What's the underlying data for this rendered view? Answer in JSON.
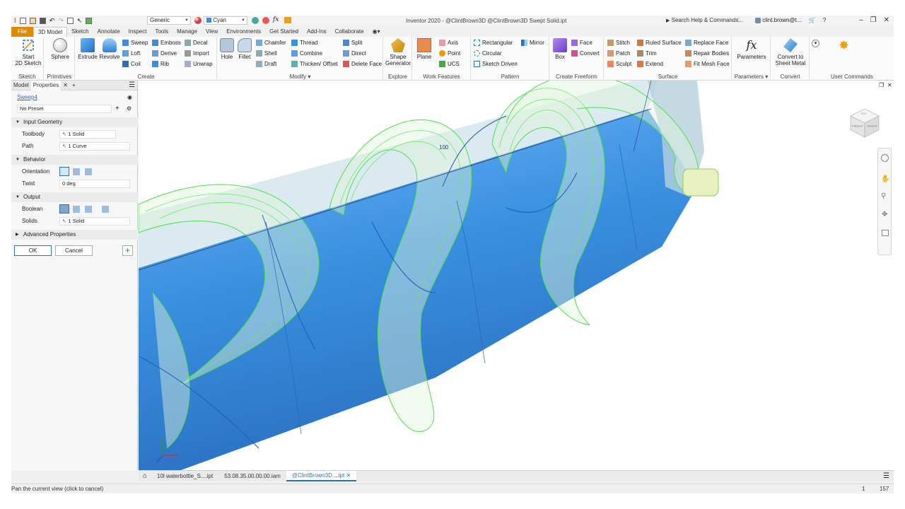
{
  "titlebar": {
    "appearance": "Generic",
    "color": "Cyan",
    "title": "Inventor 2020 - @ClintBrown3D   @ClintBrown3D Swept Solid.ipt",
    "search": "Search Help & Commands...",
    "user": "clint.brown@t..."
  },
  "tabs": [
    "File",
    "3D Model",
    "Sketch",
    "Annotate",
    "Inspect",
    "Tools",
    "Manage",
    "View",
    "Environments",
    "Get Started",
    "Add-Ins",
    "Collaborate"
  ],
  "ribbon": {
    "sketch": {
      "start": "Start",
      "start2": "2D Sketch",
      "label": "Sketch"
    },
    "primitives": {
      "sphere": "Sphere",
      "label": "Primitives"
    },
    "create": {
      "extrude": "Extrude",
      "revolve": "Revolve",
      "sweep": "Sweep",
      "loft": "Loft",
      "coil": "Coil",
      "emboss": "Emboss",
      "derive": "Derive",
      "rib": "Rib",
      "decal": "Decal",
      "import": "Import",
      "unwrap": "Unwrap",
      "label": "Create"
    },
    "modify": {
      "hole": "Hole",
      "fillet": "Fillet",
      "chamfer": "Chamfer",
      "shell": "Shell",
      "draft": "Draft",
      "thread": "Thread",
      "combine": "Combine",
      "thicken": "Thicken/ Offset",
      "split": "Split",
      "direct": "Direct",
      "delete_face": "Delete Face",
      "label": "Modify"
    },
    "explore": {
      "shape": "Shape",
      "generator": "Generator",
      "label": "Explore"
    },
    "work": {
      "plane": "Plane",
      "axis": "Axis",
      "point": "Point",
      "ucs": "UCS",
      "label": "Work Features"
    },
    "pattern": {
      "rectangular": "Rectangular",
      "circular": "Circular",
      "sketch_driven": "Sketch Driven",
      "mirror": "Mirror",
      "label": "Pattern"
    },
    "freeform": {
      "box": "Box",
      "face": "Face",
      "convert": "Convert",
      "label": "Create Freeform"
    },
    "surface": {
      "stitch": "Stitch",
      "patch": "Patch",
      "sculpt": "Sculpt",
      "ruled": "Ruled Surface",
      "trim": "Trim",
      "extend": "Extend",
      "replace": "Replace Face",
      "repair": "Repair Bodies",
      "fit_mesh": "Fit Mesh Face",
      "label": "Surface"
    },
    "parameters": {
      "btn": "Parameters",
      "label": "Parameters"
    },
    "convert": {
      "btn1": "Convert to",
      "btn2": "Sheet Metal",
      "label": "Convert"
    },
    "user": {
      "label": "User Commands"
    }
  },
  "leftpanel": {
    "tab_model": "Model",
    "tab_properties": "Properties",
    "feature": "Sweep4",
    "preset": "No Preset",
    "input_geometry": "Input Geometry",
    "profile_label": "Toolbody",
    "profile_value": "1 Solid",
    "path_label": "Path",
    "path_value": "1 Curve",
    "behavior": "Behavior",
    "orientation_label": "Orientation",
    "twist_label": "Twist",
    "twist_value": "0 deg",
    "output": "Output",
    "boolean_label": "Boolean",
    "solids_label": "Solids",
    "solids_value": "1 Solid",
    "advanced": "Advanced Properties",
    "ok": "OK",
    "cancel": "Cancel"
  },
  "viewport": {
    "dimension": "100",
    "viewcube_front": "FRONT",
    "viewcube_right": "RIGHT",
    "viewcube_top": "TOP"
  },
  "doctabs": [
    "10l waterbottle_S....ipt",
    "53.08.35.00.00.00.iam",
    "@ClintBrown3D....ipt"
  ],
  "status": {
    "message": "Pan the current view (click to cancel)",
    "n1": "1",
    "n2": "157"
  },
  "colors": {
    "accent": "#e08a00",
    "solid": "#3a8fe0",
    "sweep": "#4ee04e"
  }
}
